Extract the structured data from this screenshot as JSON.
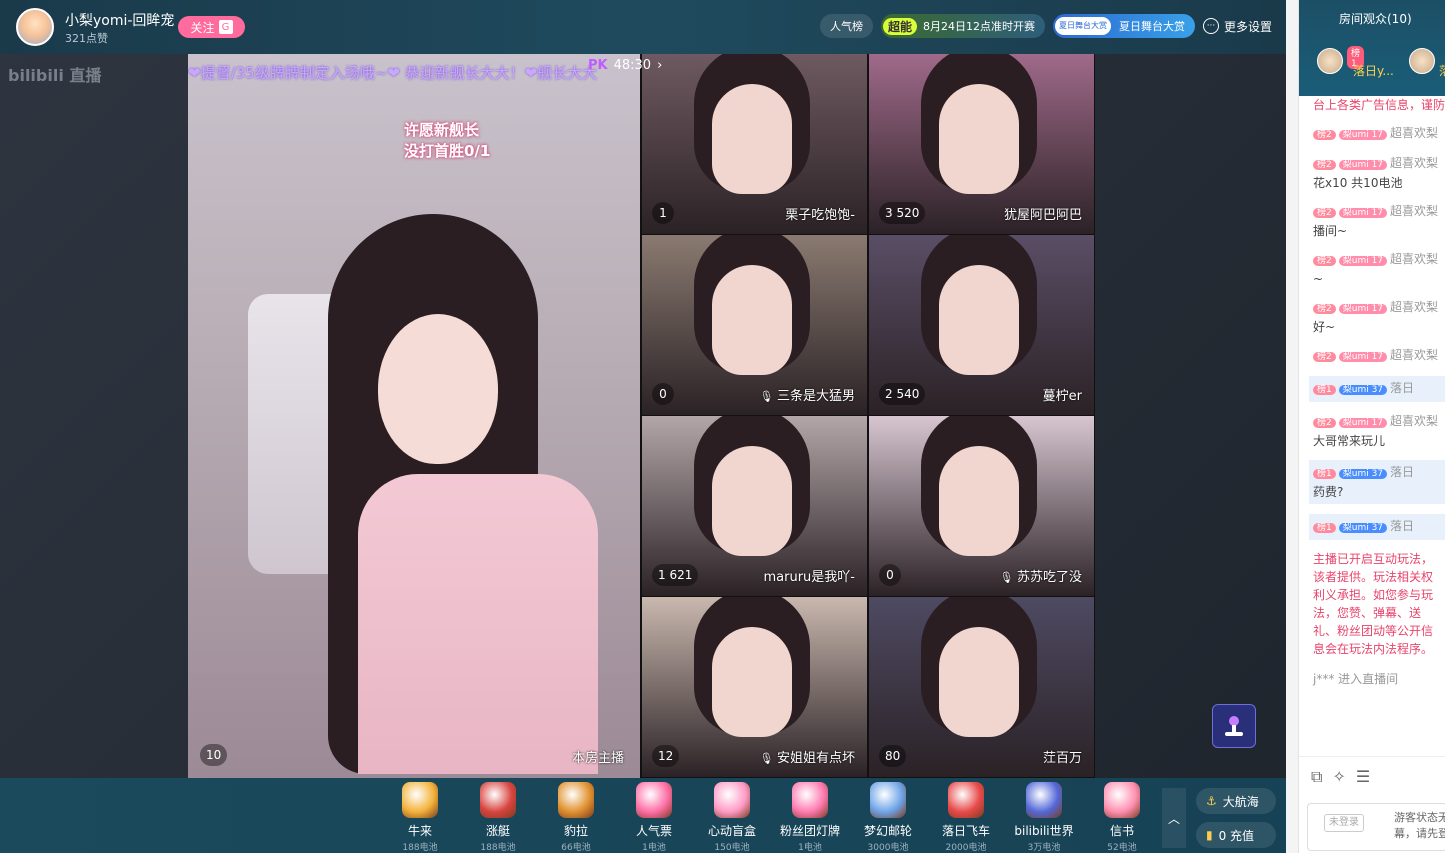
{
  "header": {
    "host_name": "小梨yomi-回眸宠",
    "likes": "321点赞",
    "follow_label": "关注",
    "follow_badge": "G",
    "popularity_label": "人气榜",
    "super_tag": "超能",
    "super_text": "8月24日12点准时开赛",
    "summer_tag": "夏日舞台大赏",
    "summer_text": "夏日舞台大赏",
    "more_settings": "更多设置"
  },
  "logo_text": "bilibili 直播",
  "video": {
    "marquee": "❤提督/35级牌牌制定入场哦~❤  恭迎新舰长大大！❤舰长大大",
    "pk_timer": "48:30",
    "wish_text": "许愿新舰长\n没打首胜0/1",
    "host_badge": "10",
    "host_label": "本房主播",
    "tiles": [
      {
        "badge": "1",
        "name": "栗子吃饱饱-",
        "mic": false,
        "bg": "#6e5a60"
      },
      {
        "badge": "3 520",
        "name": "犹屋阿巴阿巴",
        "mic": false,
        "bg": "#a06a8a"
      },
      {
        "badge": "0",
        "name": "三条是大猛男",
        "mic": true,
        "bg": "#8a7a70"
      },
      {
        "badge": "2 540",
        "name": "蔓柠er",
        "mic": false,
        "bg": "#5a4e66"
      },
      {
        "badge": "1 621",
        "name": "maruru是我吖-",
        "mic": false,
        "bg": "#b3a6a8"
      },
      {
        "badge": "0",
        "name": "苏苏吃了没",
        "mic": true,
        "bg": "#d7c6d0"
      },
      {
        "badge": "12",
        "name": "安姐姐有点坏",
        "mic": true,
        "bg": "#c9b8ae"
      },
      {
        "badge": "80",
        "name": "茳百万",
        "mic": false,
        "bg": "#4e4a62"
      }
    ]
  },
  "gifts": [
    {
      "name": "牛来",
      "price": "188电池",
      "color": "#f3b23a"
    },
    {
      "name": "涨艇",
      "price": "188电池",
      "color": "#d8443e"
    },
    {
      "name": "豹拉",
      "price": "66电池",
      "color": "#e0912f"
    },
    {
      "name": "人气票",
      "price": "1电池",
      "color": "#ff6fa6"
    },
    {
      "name": "心动盲盒",
      "price": "150电池",
      "color": "#ff9ac5"
    },
    {
      "name": "粉丝团灯牌",
      "price": "1电池",
      "color": "#ff7bb0"
    },
    {
      "name": "梦幻邮轮",
      "price": "3000电池",
      "color": "#6ea4e8"
    },
    {
      "name": "落日飞车",
      "price": "2000电池",
      "color": "#e84a4a"
    },
    {
      "name": "bilibili世界",
      "price": "3万电池",
      "color": "#5468d8"
    },
    {
      "name": "信书",
      "price": "52电池",
      "color": "#ff8fb0"
    }
  ],
  "fleet_label": "大航海",
  "recharge_label": "0 充值",
  "sidebar": {
    "title": "房间观众(10)",
    "audience": [
      {
        "rank": "榜1",
        "name": "落日y..."
      },
      {
        "rank": "",
        "name": "落"
      }
    ],
    "messages": [
      {
        "text": "台上各类广告信息，谨防",
        "type": "notice"
      },
      {
        "rank": "榜2",
        "fan": "梨umi 17",
        "user": "超喜欢梨",
        "content": "",
        "type": "plain"
      },
      {
        "rank": "榜2",
        "fan": "梨umi 17",
        "user": "超喜欢梨",
        "content": "花x10 共10电池",
        "type": "plain"
      },
      {
        "rank": "榜2",
        "fan": "梨umi 17",
        "user": "超喜欢梨",
        "content": "播间~",
        "type": "plain"
      },
      {
        "rank": "榜2",
        "fan": "梨umi 17",
        "user": "超喜欢梨",
        "content": "~",
        "type": "plain"
      },
      {
        "rank": "榜2",
        "fan": "梨umi 17",
        "user": "超喜欢梨",
        "content": "好~",
        "type": "plain"
      },
      {
        "rank": "榜2",
        "fan": "梨umi 17",
        "user": "超喜欢梨",
        "content": "",
        "type": "plain"
      },
      {
        "rank": "榜1",
        "fan": "梨umi 37",
        "user": "落日",
        "content": "",
        "type": "blue"
      },
      {
        "rank": "榜2",
        "fan": "梨umi 17",
        "user": "超喜欢梨",
        "content": "大哥常来玩儿",
        "type": "plain"
      },
      {
        "rank": "榜1",
        "fan": "梨umi 37",
        "user": "落日",
        "content": "药费?",
        "type": "blue"
      },
      {
        "rank": "榜1",
        "fan": "梨umi 37",
        "user": "落日",
        "content": "",
        "type": "blue"
      }
    ],
    "notice": "主播已开启互动玩法，该者提供。玩法相关权利义承担。如您参与玩法，您赞、弹幕、送礼、粉丝团动等公开信息会在玩法内法程序。",
    "enter_text": "j*** 进入直播间",
    "login_button": "未登录",
    "login_tip": "游客状态无\n幕，请先登"
  },
  "colors": {
    "accent": "#ff6b9d",
    "header_bg": "#1f4a5e",
    "gift_bar_bg": "#174255"
  }
}
